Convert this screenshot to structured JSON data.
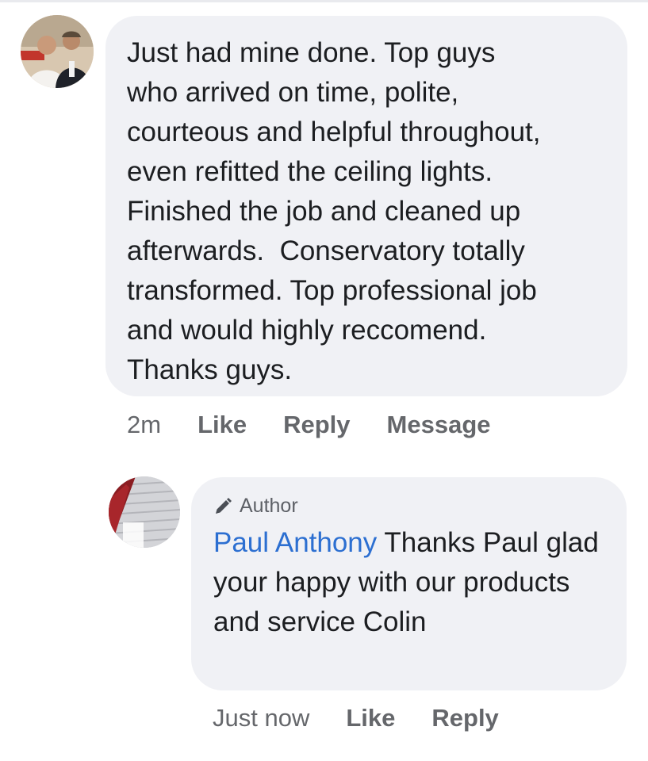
{
  "comment": {
    "avatar_icon": "user-avatar-photo",
    "body": "Just had mine done. Top guys\nwho arrived on time, polite,\ncourteous and helpful throughout,\neven refitted the ceiling lights.\nFinished the job and cleaned up\nafterwards.  Conservatory totally\ntransformed. Top professional job\nand would highly reccomend.\nThanks guys.",
    "timestamp": "2m",
    "like_label": "Like",
    "reply_label": "Reply",
    "message_label": "Message"
  },
  "reply": {
    "avatar_icon": "page-avatar-photo",
    "badge_icon": "pencil-icon",
    "badge_label": "Author",
    "mention": "Paul Anthony",
    "body": " Thanks Paul glad your happy with our products and service Colin",
    "timestamp": "Just now",
    "like_label": "Like",
    "reply_label": "Reply"
  },
  "colors": {
    "bubble": "#f0f1f5",
    "mention": "#2c6fd1",
    "meta": "#65676b",
    "text": "#1c1e21"
  }
}
